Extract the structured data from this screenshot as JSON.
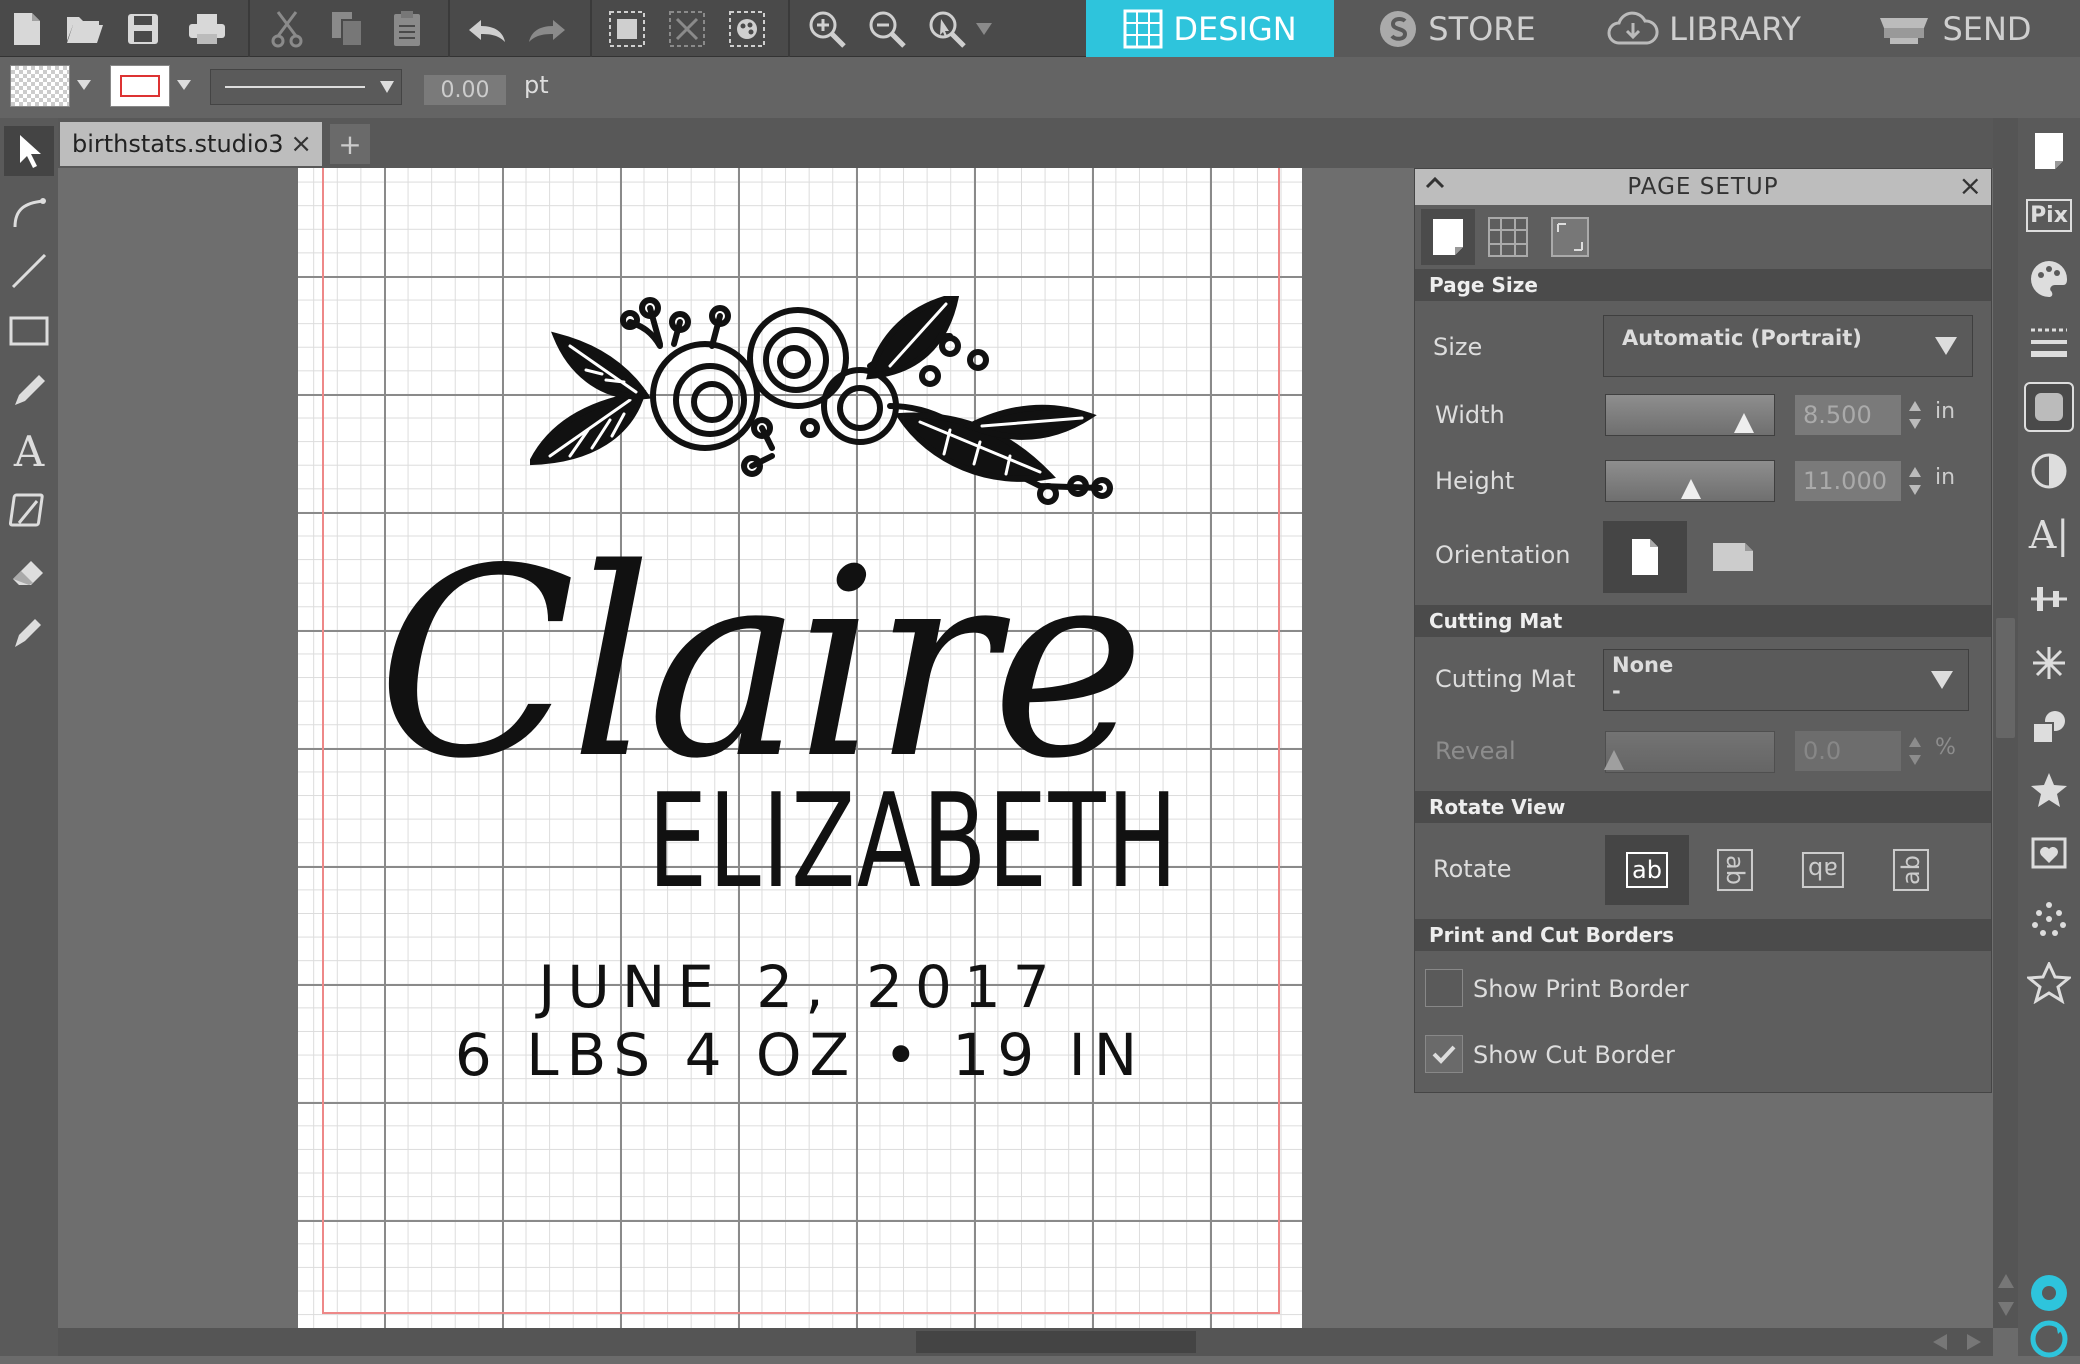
{
  "topnav": {
    "tabs": [
      {
        "label": "DESIGN",
        "icon": "grid-icon"
      },
      {
        "label": "STORE",
        "icon": "silhouette-s-icon"
      },
      {
        "label": "LIBRARY",
        "icon": "cloud-download-icon"
      },
      {
        "label": "SEND",
        "icon": "cutter-icon"
      }
    ],
    "active_tab": "DESIGN",
    "accent_color": "#2ec4dc"
  },
  "toolbar": {
    "icons": [
      "new-file-icon",
      "open-folder-icon",
      "save-icon",
      "print-icon",
      "cut-icon",
      "copy-icon",
      "paste-icon",
      "undo-icon",
      "redo-icon",
      "group-icon",
      "ungroup-icon",
      "fill-icon",
      "zoom-in-icon",
      "zoom-out-icon",
      "zoom-select-icon"
    ]
  },
  "toolbar2": {
    "line_width_value": "0.00",
    "line_width_unit": "pt"
  },
  "document": {
    "tab_name": "birthstats.studio3",
    "close_glyph": "×",
    "new_tab_glyph": "+"
  },
  "design": {
    "name_script": "Claire",
    "middle_name": "ELIZABETH",
    "date_line": "JUNE 2, 2017",
    "stats_line": "6 LBS 4 OZ • 19 IN"
  },
  "page_setup": {
    "title": "PAGE SETUP",
    "collapse_glyph": "^",
    "close_glyph": "×",
    "sections": {
      "page_size": "Page Size",
      "cutting_mat": "Cutting Mat",
      "rotate_view": "Rotate View",
      "borders": "Print and Cut Borders"
    },
    "size_label": "Size",
    "size_value": "Automatic (Portrait)",
    "width_label": "Width",
    "width_value": "8.500",
    "width_unit": "in",
    "width_slider_level": 0.85,
    "height_label": "Height",
    "height_value": "11.000",
    "height_unit": "in",
    "height_slider_level": 0.5,
    "orientation_label": "Orientation",
    "cutting_mat_label": "Cutting Mat",
    "cutting_mat_value": "None",
    "cutting_mat_sub": "-",
    "reveal_label": "Reveal",
    "reveal_value": "0.0",
    "reveal_unit": "%",
    "rotate_label": "Rotate",
    "rotate_glyph": "ab",
    "show_print_border": "Show Print Border",
    "show_print_border_checked": false,
    "show_cut_border": "Show Cut Border",
    "show_cut_border_checked": true
  }
}
